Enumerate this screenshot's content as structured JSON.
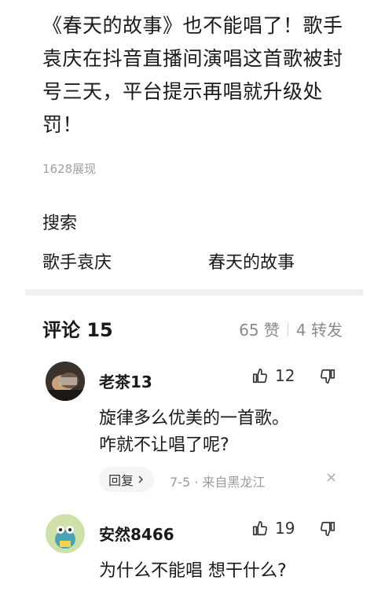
{
  "post": {
    "title": "《春天的故事》也不能唱了！歌手袁庆在抖音直播间演唱这首歌被封号三天，平台提示再唱就升级处罚！",
    "views": "1628展现"
  },
  "search": {
    "label": "搜索",
    "terms": [
      "歌手袁庆",
      "春天的故事"
    ]
  },
  "comments_section": {
    "title": "评论 15",
    "likes": "65 赞",
    "shares": "4 转发"
  },
  "comments": [
    {
      "username": "老茶13",
      "like_count": "12",
      "text_lines": [
        "旋律多么优美的一首歌。",
        "咋就不让唱了呢?"
      ],
      "reply_label": "回复",
      "meta": "7-5 · 来自黑龙江"
    },
    {
      "username": "安然8466",
      "like_count": "19",
      "text_lines": [
        "为什么不能唱 想干什么?"
      ]
    }
  ],
  "icons": {
    "like": "thumbs-up-icon",
    "dislike": "thumbs-down-icon",
    "reply_chevron": "chevron-right-icon",
    "close": "close-icon"
  }
}
